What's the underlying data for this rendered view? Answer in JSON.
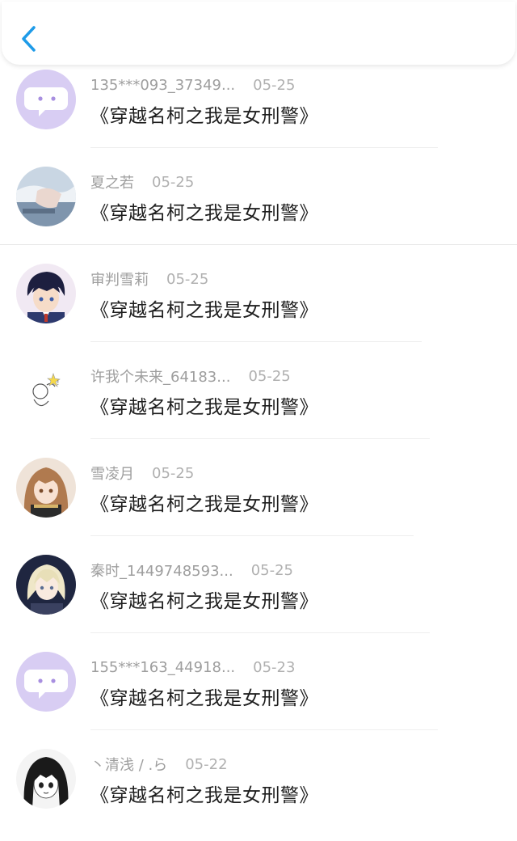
{
  "header": {
    "back_icon": "chevron-left-icon",
    "accent": "#1e9be8"
  },
  "comments": [
    {
      "user": "135***093_37349...",
      "date": "05-25",
      "text": "《穿越名柯之我是女刑警》",
      "avatar": "default-chat-avatar",
      "avatar_color": "#d8cdf3"
    },
    {
      "user": "夏之若",
      "date": "05-25",
      "text": "《穿越名柯之我是女刑警》",
      "avatar": "photo-avatar",
      "avatar_color": "#9fb4c9"
    },
    {
      "user": "审判雪莉",
      "date": "05-25",
      "text": "《穿越名柯之我是女刑警》",
      "avatar": "anime-boy-avatar",
      "avatar_color": "#3a3c63"
    },
    {
      "user": "许我个未来_64183...",
      "date": "05-25",
      "text": "《穿越名柯之我是女刑警》",
      "avatar": "sketch-avatar",
      "avatar_color": "#ffffff"
    },
    {
      "user": "雪凌月",
      "date": "05-25",
      "text": "《穿越名柯之我是女刑警》",
      "avatar": "anime-girl-avatar",
      "avatar_color": "#c08a5e"
    },
    {
      "user": "秦时_1449748593...",
      "date": "05-25",
      "text": "《穿越名柯之我是女刑警》",
      "avatar": "anime-blond-avatar",
      "avatar_color": "#1f2640"
    },
    {
      "user": "155***163_44918...",
      "date": "05-23",
      "text": "《穿越名柯之我是女刑警》",
      "avatar": "default-chat-avatar",
      "avatar_color": "#d8cdf3"
    },
    {
      "user": "丶清浅 / .ら",
      "date": "05-22",
      "text": "《穿越名柯之我是女刑警》",
      "avatar": "anime-manga-avatar",
      "avatar_color": "#2a2a2a"
    }
  ]
}
